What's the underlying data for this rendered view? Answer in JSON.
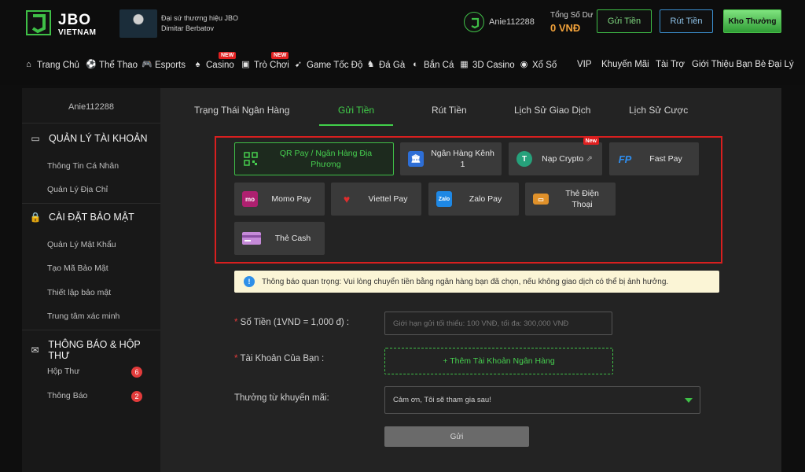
{
  "header": {
    "logo_line1": "JBO",
    "logo_line2": "VIETNAM",
    "ambassador_line1": "Đại sứ thương hiệu JBO",
    "ambassador_line2": "Dimitar Berbatov",
    "username": "Anie112288",
    "balance_label": "Tổng Số Dư",
    "balance_value": "0 VNĐ",
    "deposit_btn": "Gửi Tiền",
    "withdraw_btn": "Rút Tiền",
    "reward_btn": "Kho Thưởng"
  },
  "nav": {
    "items": [
      {
        "label": "Trang Chủ",
        "icon": "home-icon"
      },
      {
        "label": "Thể Thao",
        "icon": "soccer-ball-icon"
      },
      {
        "label": "Esports",
        "icon": "gamepad-icon"
      },
      {
        "label": "Casino",
        "icon": "cards-icon",
        "badge": "NEW"
      },
      {
        "label": "Trò Chơi",
        "icon": "slot-machine-icon",
        "badge": "NEW"
      },
      {
        "label": "Game Tốc Độ",
        "icon": "speed-icon"
      },
      {
        "label": "Đá Gà",
        "icon": "rooster-icon"
      },
      {
        "label": "Bắn Cá",
        "icon": "fish-icon"
      },
      {
        "label": "3D Casino",
        "icon": "3d-icon"
      },
      {
        "label": "Xổ Số",
        "icon": "lottery-icon"
      },
      {
        "label": "VIP"
      },
      {
        "label": "Khuyến Mãi"
      },
      {
        "label": "Tài Trợ"
      },
      {
        "label": "Giới Thiệu Bạn Bè"
      },
      {
        "label": "Đại Lý"
      }
    ]
  },
  "sidebar": {
    "username": "Anie112288",
    "sections": [
      {
        "title": "QUẢN LÝ TÀI KHOẢN",
        "icon": "id-card-icon",
        "items": [
          "Thông Tin Cá Nhân",
          "Quản Lý Địa Chỉ"
        ]
      },
      {
        "title": "CÀI ĐẶT BẢO MẬT",
        "icon": "lock-icon",
        "items": [
          "Quản Lý Mật Khẩu",
          "Tạo Mã Bảo Mật",
          "Thiết lập bảo mật",
          "Trung tâm xác minh"
        ]
      },
      {
        "title": "THÔNG BÁO & HỘP THƯ",
        "icon": "mail-icon",
        "items": [
          "Hộp Thư",
          "Thông Báo"
        ],
        "badges": [
          "6",
          "2"
        ]
      }
    ]
  },
  "tabs": [
    "Trạng Thái Ngân Hàng",
    "Gửi Tiền",
    "Rút Tiền",
    "Lịch Sử Giao Dịch",
    "Lịch Sử Cược"
  ],
  "active_tab": "Gửi Tiền",
  "methods": [
    {
      "label": "QR Pay / Ngân Hàng Địa Phương",
      "icon": "qr-code-icon",
      "active": true
    },
    {
      "label": "Ngân Hàng Kênh 1",
      "icon": "bank-icon"
    },
    {
      "label": "Nạp Crypto",
      "icon": "tether-icon",
      "badge": "New"
    },
    {
      "label": "Fast Pay",
      "icon": "fastpay-icon"
    },
    {
      "label": "Momo Pay",
      "icon": "momo-icon"
    },
    {
      "label": "Viettel Pay",
      "icon": "viettel-icon"
    },
    {
      "label": "Zalo Pay",
      "icon": "zalo-icon"
    },
    {
      "label": "Thẻ Điện Thoại",
      "icon": "phone-card-icon"
    },
    {
      "label": "Thẻ Cash",
      "icon": "cash-card-icon"
    }
  ],
  "notice": "Thông báo quan trọng: Vui lòng chuyển tiền bằng ngân hàng bạn đã chọn, nếu không giao dịch có thể bị ảnh hưởng.",
  "form": {
    "amount_label": "Số Tiền (1VND = 1,000 đ)  :",
    "amount_placeholder": "Giới hạn gửi tối thiểu: 100 VNĐ, tối đa: 300,000 VNĐ",
    "account_label": "Tài Khoản Của Bạn :",
    "add_account": "+ Thêm Tài Khoản Ngân Hàng",
    "promo_label": "Thưởng từ khuyến mãi:",
    "promo_value": "Cảm ơn, Tôi sẽ tham gia sau!",
    "submit": "Gửi"
  },
  "colors": {
    "accent": "#41d04a",
    "highlight_border": "#d81f1f",
    "balance": "#f2a23a"
  }
}
